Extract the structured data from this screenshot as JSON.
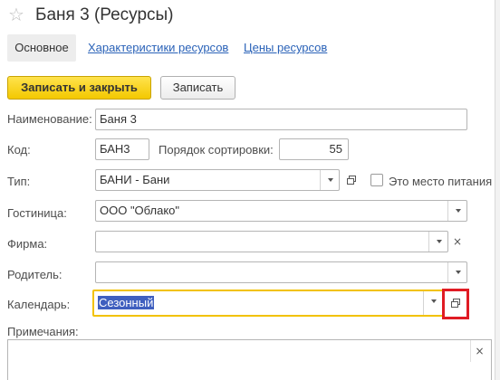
{
  "window": {
    "title": "Баня 3 (Ресурсы)",
    "favorite_glyph": "☆"
  },
  "tabs": [
    {
      "label": "Основное",
      "active": true
    },
    {
      "label": "Характеристики ресурсов",
      "active": false
    },
    {
      "label": "Цены ресурсов",
      "active": false
    }
  ],
  "toolbar": {
    "save_close_label": "Записать и закрыть",
    "save_label": "Записать"
  },
  "form": {
    "name": {
      "label": "Наименование:",
      "value": "Баня 3"
    },
    "code": {
      "label": "Код:",
      "value": "БАН3"
    },
    "sort_order": {
      "label": "Порядок сортировки:",
      "value": "55"
    },
    "type": {
      "label": "Тип:",
      "value": "БАНИ - Бани"
    },
    "food_place": {
      "label": "Это место питания",
      "checked": false
    },
    "hotel": {
      "label": "Гостиница:",
      "value": "ООО \"Облако\""
    },
    "company": {
      "label": "Фирма:",
      "value": ""
    },
    "parent": {
      "label": "Родитель:",
      "value": ""
    },
    "calendar": {
      "label": "Календарь:",
      "value": "Сезонный"
    },
    "notes": {
      "label": "Примечания:",
      "value": ""
    }
  },
  "icons": {
    "dropdown": "chevron-down-icon",
    "open": "open-form-icon",
    "clear": "clear-icon",
    "clear_glyph": "×"
  },
  "colors": {
    "primary_button": "#f3c800",
    "link": "#2a62b8",
    "focus_border": "#f2c200",
    "highlight": "#e01b24",
    "selection": "#3f5fbf"
  }
}
